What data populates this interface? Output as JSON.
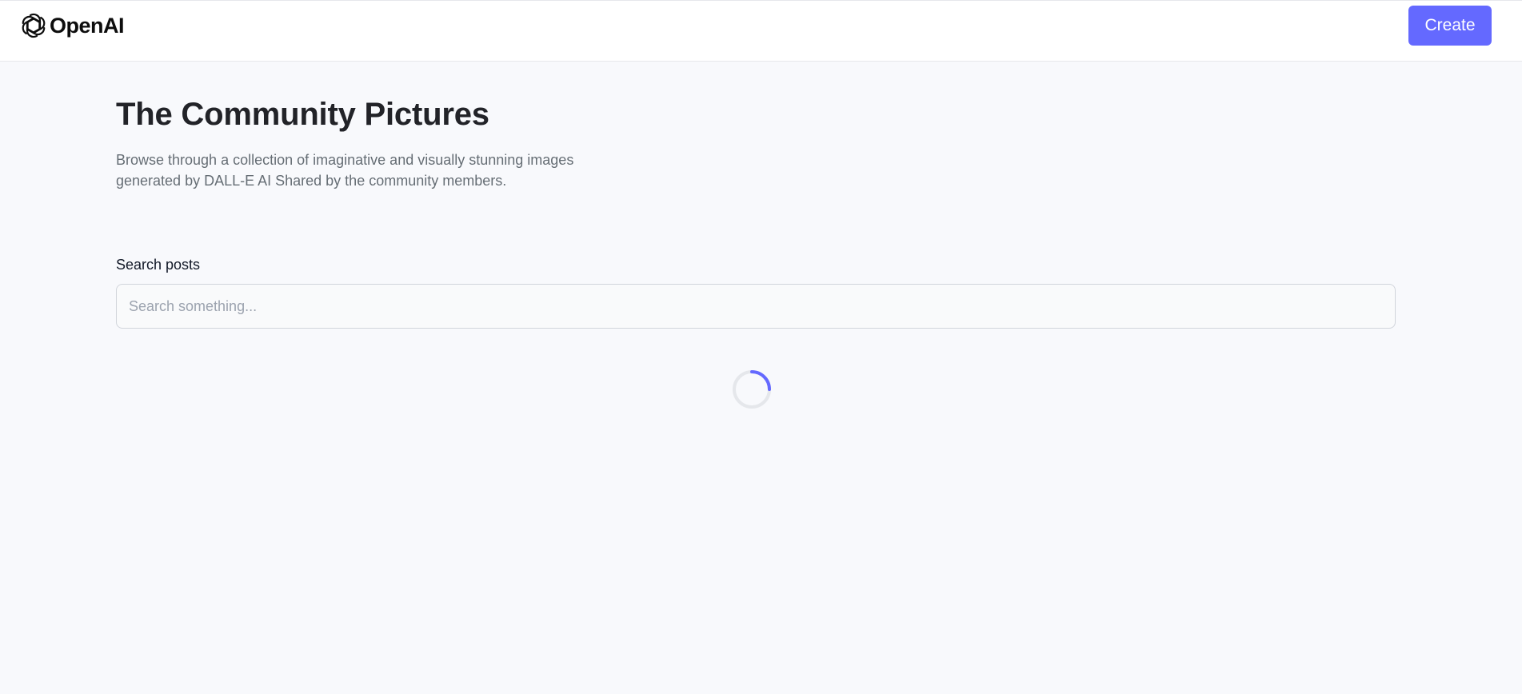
{
  "header": {
    "brand": "OpenAI",
    "create_label": "Create"
  },
  "main": {
    "title": "The Community Pictures",
    "subtitle": "Browse through a collection of imaginative and visually stunning images generated by DALL-E AI Shared by the community members.",
    "search": {
      "label": "Search posts",
      "placeholder": "Search something...",
      "value": ""
    }
  },
  "icons": {
    "logo": "openai-logo-icon",
    "loader": "loading-spinner-icon"
  },
  "colors": {
    "accent": "#6469ff",
    "title": "#222328",
    "subtitle": "#666e75",
    "background": "#f8f9fc",
    "spinner_track": "#e5e7eb"
  }
}
